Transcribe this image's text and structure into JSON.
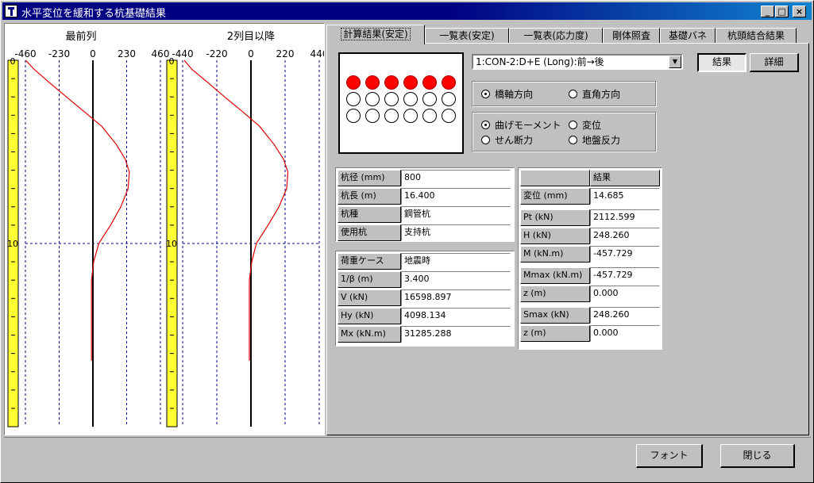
{
  "window": {
    "title": "水平変位を緩和する杭基礎結果",
    "minimize_label": "_",
    "maximize_label": "□",
    "close_label": "×"
  },
  "charts": {
    "left": {
      "title": "最前列",
      "x_ticks": [
        "-460",
        "-230",
        "0",
        "230",
        "460"
      ]
    },
    "right": {
      "title": "2列目以降",
      "x_ticks": [
        "-440",
        "-220",
        "0",
        "220",
        "440"
      ]
    },
    "depth_labels": [
      "0",
      "10"
    ]
  },
  "chart_data": [
    {
      "type": "line",
      "title": "最前列",
      "xlabel": "",
      "ylabel": "",
      "xlim": [
        -460,
        460
      ],
      "ylim": [
        0,
        20
      ],
      "x_ticks": [
        -460,
        -230,
        0,
        230,
        460
      ],
      "y_ticks_labeled": [
        0,
        10
      ],
      "series": [
        {
          "x": [
            -457.7,
            -400,
            -300,
            -180,
            -60,
            60,
            160,
            220,
            248.3,
            240,
            190,
            120,
            40,
            5,
            -10,
            -10,
            -10,
            -10,
            -10
          ],
          "y": [
            0,
            0.5,
            1.2,
            2.0,
            2.8,
            3.6,
            4.6,
            5.4,
            6.1,
            7.0,
            8.0,
            9.0,
            10.0,
            11.0,
            12.0,
            13.0,
            14.0,
            15.0,
            16.4
          ]
        }
      ]
    },
    {
      "type": "line",
      "title": "2列目以降",
      "xlabel": "",
      "ylabel": "",
      "xlim": [
        -440,
        440
      ],
      "ylim": [
        0,
        20
      ],
      "x_ticks": [
        -440,
        -220,
        0,
        220,
        440
      ],
      "y_ticks_labeled": [
        0,
        10
      ],
      "series": [
        {
          "x": [
            -430,
            -380,
            -280,
            -170,
            -55,
            55,
            150,
            210,
            238,
            230,
            180,
            110,
            35,
            5,
            -10,
            -10,
            -10,
            -10,
            -10
          ],
          "y": [
            0,
            0.5,
            1.2,
            2.0,
            2.8,
            3.6,
            4.6,
            5.4,
            6.1,
            7.0,
            8.0,
            9.0,
            10.0,
            11.0,
            12.0,
            13.0,
            14.0,
            15.0,
            16.4
          ]
        }
      ]
    }
  ],
  "tabs": [
    "計算結果(安定)",
    "一覧表(安定)",
    "一覧表(応力度)",
    "剛体照査",
    "基礎バネ",
    "杭頭結合結果"
  ],
  "case_select": {
    "value": "1:CON-2:D+E (Long):前→後"
  },
  "buttons": {
    "result": "結果",
    "detail": "詳細",
    "font": "フォント",
    "close": "閉じる"
  },
  "direction": {
    "opt1": "橋軸方向",
    "opt2": "直角方向"
  },
  "quantity": {
    "opt1": "曲げモーメント",
    "opt2": "変位",
    "opt3": "せん断力",
    "opt4": "地盤反力"
  },
  "pile_info": [
    {
      "label": "杭径 (mm)",
      "value": "800"
    },
    {
      "label": "杭長 (m)",
      "value": "16.400"
    },
    {
      "label": "杭種",
      "value": "鋼管杭"
    },
    {
      "label": "使用杭",
      "value": "支持杭"
    }
  ],
  "load_info": [
    {
      "label": "荷重ケース",
      "value": "地震時"
    },
    {
      "label": "1/β (m)",
      "value": "3.400"
    },
    {
      "label": "V (kN)",
      "value": "16598.897"
    },
    {
      "label": "Hy (kN)",
      "value": "4098.134"
    },
    {
      "label": "Mx (kN.m)",
      "value": "31285.288"
    }
  ],
  "results": {
    "header": "結果",
    "rows": [
      {
        "label": "変位 (mm)",
        "value": "14.685"
      },
      {
        "label": "Pt (kN)",
        "value": "2112.599"
      },
      {
        "label": "H (kN)",
        "value": "248.260"
      },
      {
        "label": "M (kN.m)",
        "value": "-457.729"
      },
      {
        "label": "Mmax (kN.m)",
        "value": "-457.729"
      },
      {
        "label": "z (m)",
        "value": "0.000"
      },
      {
        "label": "Smax (kN)",
        "value": "248.260"
      },
      {
        "label": "z (m)",
        "value": "0.000"
      }
    ]
  }
}
